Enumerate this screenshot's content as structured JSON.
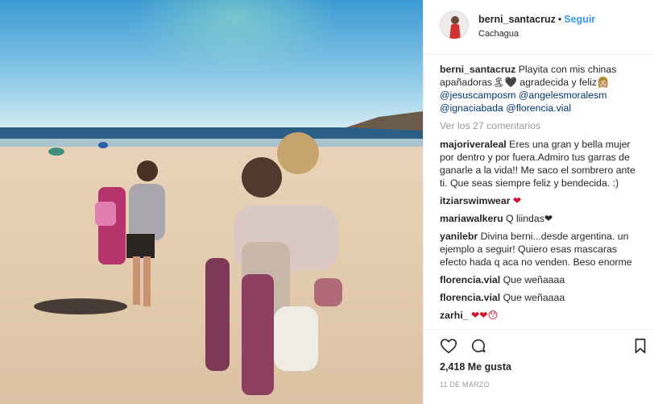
{
  "post": {
    "image_alt": "Three friends on a sunny beach",
    "author": {
      "username": "berni_santacruz",
      "separator": "•",
      "follow_label": "Seguir",
      "location": "Cachagua"
    },
    "caption": {
      "username": "berni_santacruz",
      "text": "Playita con mis chinas apañadoras🏝🖤 agradecida y feliz👩🏼",
      "mentions": [
        "@jesuscamposm",
        "@angelesmoralesm",
        "@ignaciabada",
        "@florencia.vial"
      ]
    },
    "view_all_comments": "Ver los 27 comentarios",
    "comments": [
      {
        "username": "majoriveraleal",
        "text": "Eres una gran y bella mujer por dentro y por fuera.Admiro tus garras de ganarle a la vida!! Me saco el sombrero ante ti. Que seas siempre feliz y bendecida. :)"
      },
      {
        "username": "itziarswimwear",
        "text": "❤"
      },
      {
        "username": "mariawalkeru",
        "text": "Q liindas❤"
      },
      {
        "username": "yanilebr",
        "text": "Divina berni...desde argentina. un ejemplo a seguir! Quiero esas mascaras efecto hada q aca no venden. Beso enorme"
      },
      {
        "username": "florencia.vial",
        "text": "Que weñaaaa"
      },
      {
        "username": "florencia.vial",
        "text": "Que weñaaaa"
      },
      {
        "username": "zarhi_",
        "text": "❤❤😯"
      }
    ],
    "likes": "2,418 Me gusta",
    "date": "11 DE MARZO",
    "icons": {
      "like": "heart-outline-icon",
      "comment": "speech-bubble-icon",
      "save": "bookmark-icon"
    },
    "colors": {
      "link": "#3897f0",
      "mention": "#003569",
      "muted": "#999999",
      "text": "#262626"
    }
  }
}
